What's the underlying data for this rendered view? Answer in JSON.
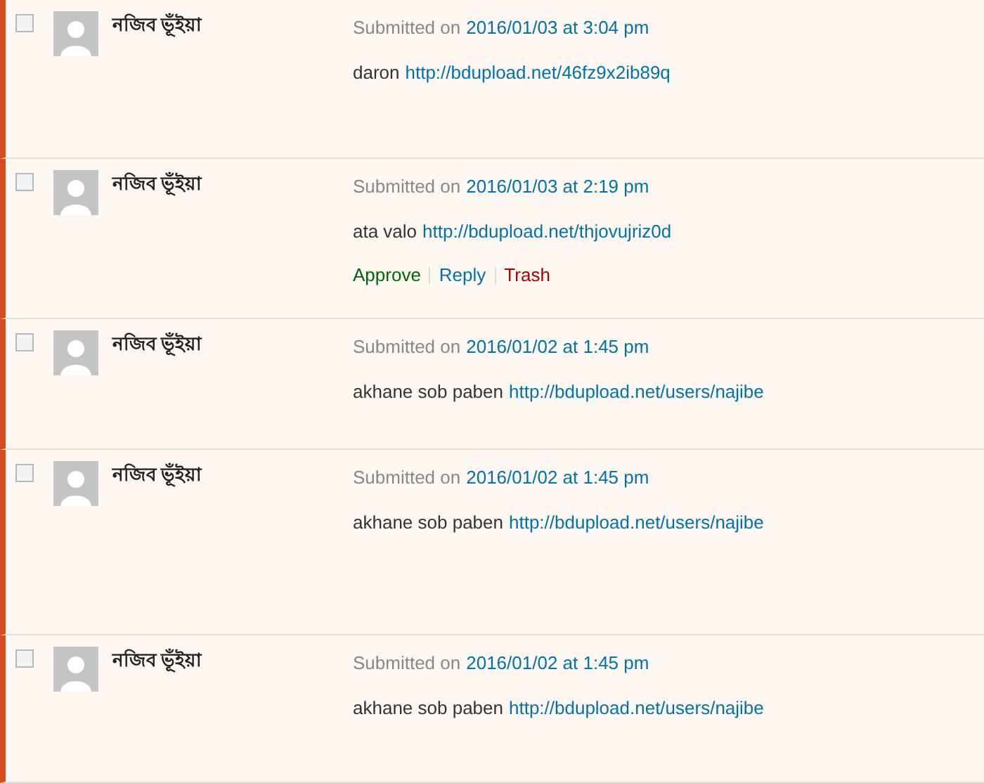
{
  "comments": [
    {
      "checked": false,
      "author": "নজিব ভূঁইয়া",
      "submitted_label": "Submitted on",
      "date": "2016/01/03 at 3:04 pm",
      "text": "daron",
      "link": "http://bdupload.net/46fz9x2ib89q"
    },
    {
      "checked": false,
      "author": "নজিব ভূঁইয়া",
      "submitted_label": "Submitted on",
      "date": "2016/01/03 at 2:19 pm",
      "text": "ata valo",
      "link": "http://bdupload.net/thjovujriz0d",
      "actions": [
        {
          "kind": "approve",
          "label": "Approve"
        },
        {
          "kind": "reply",
          "label": "Reply"
        },
        {
          "kind": "trash",
          "label": "Trash"
        }
      ]
    },
    {
      "checked": false,
      "author": "নজিব ভূঁইয়া",
      "submitted_label": "Submitted on",
      "date": "2016/01/02 at 1:45 pm",
      "text": "akhane sob paben",
      "link": "http://bdupload.net/users/najibe"
    },
    {
      "checked": false,
      "author": "নজিব ভূঁইয়া",
      "submitted_label": "Submitted on",
      "date": "2016/01/02 at 1:45 pm",
      "text": "akhane sob paben",
      "link": "http://bdupload.net/users/najibe"
    },
    {
      "checked": false,
      "author": "নজিব ভূঁইয়া",
      "submitted_label": "Submitted on",
      "date": "2016/01/02 at 1:45 pm",
      "text": "akhane sob paben",
      "link": "http://bdupload.net/users/najibe"
    }
  ]
}
